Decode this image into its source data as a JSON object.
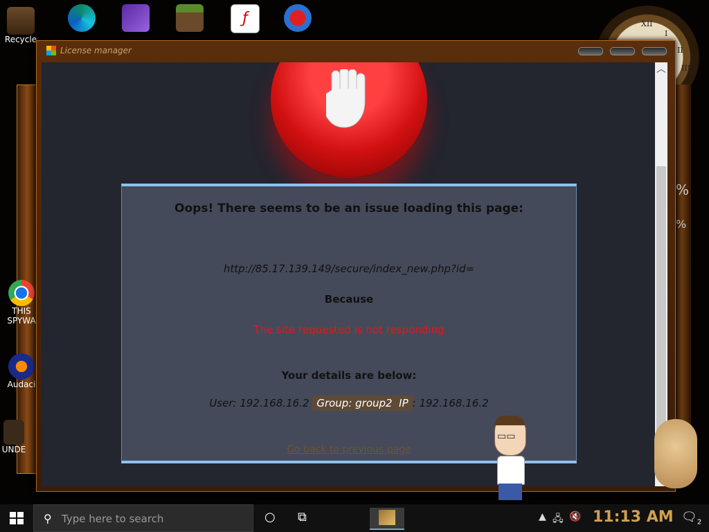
{
  "desktop": {
    "icons": [
      {
        "name": "Recycle",
        "label": "Recycle"
      },
      {
        "name": "Edge",
        "label": ""
      },
      {
        "name": "Visual Studio",
        "label": ""
      },
      {
        "name": "Minecraft",
        "label": ""
      },
      {
        "name": "Flash",
        "label": ""
      },
      {
        "name": "PowerPoint",
        "label": ""
      }
    ],
    "left_labels": [
      "THIS",
      "SPYWA",
      "Audaci",
      "UNDE"
    ],
    "right_labels": [
      "%",
      "%"
    ],
    "clock_numerals": [
      "XII",
      "I",
      "II",
      "III"
    ]
  },
  "window": {
    "title": "License manager"
  },
  "page": {
    "heading": "Oops! There seems to be an issue loading this page:",
    "url": "http://85.17.139.149/secure/index_new.php?id=",
    "because_label": "Because",
    "reason": "The site requested is not responding",
    "details_label": "Your details are below:",
    "user_prefix": "User: ",
    "user_value": "192.168.16.2",
    "group_prefix": "Group: ",
    "group_value": "group2",
    "ip_prefix": "IP",
    "ip_value": ": 192.168.16.2",
    "go_back": "Go back to previous page"
  },
  "taskbar": {
    "search_placeholder": "Type here to search",
    "clock": "11:13 AM",
    "notifications_count": "2"
  },
  "colors": {
    "accent_blue": "#8ec2ef",
    "error_red": "#e01818",
    "clock_gold": "#d2a050"
  }
}
